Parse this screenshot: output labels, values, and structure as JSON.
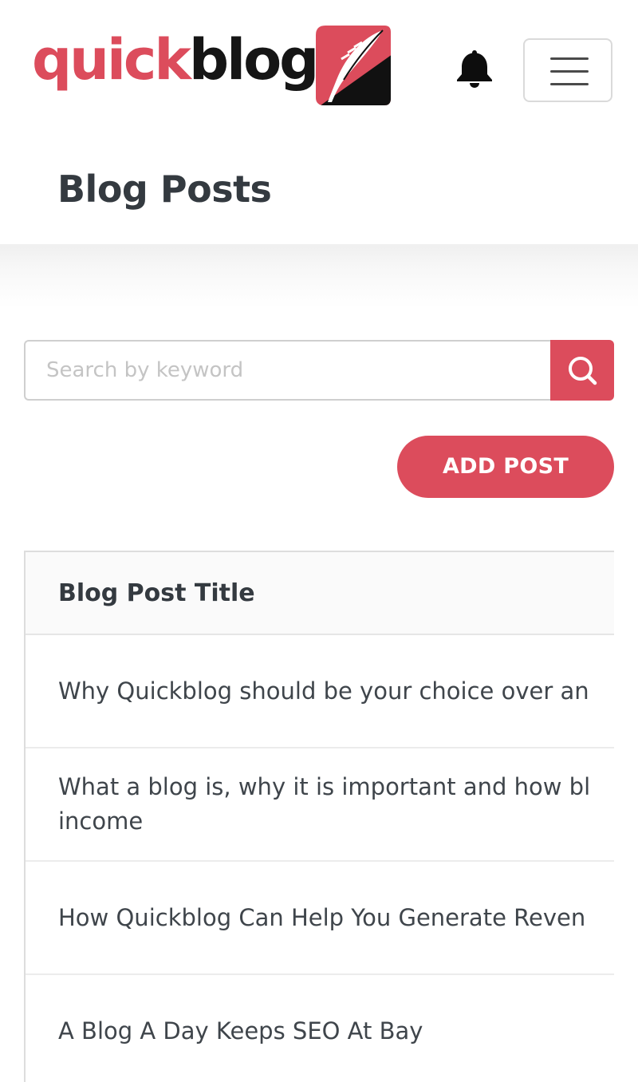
{
  "brand": {
    "name_part1": "quick",
    "name_part2": "blog",
    "accent_color": "#dc4c5c",
    "dark_color": "#151515"
  },
  "header": {
    "notification_icon": "bell-icon",
    "menu_icon": "hamburger-menu-icon"
  },
  "page": {
    "title": "Blog Posts"
  },
  "search": {
    "placeholder": "Search by keyword",
    "value": "",
    "icon": "search-icon"
  },
  "actions": {
    "add_post_label": "ADD POST"
  },
  "table": {
    "columns": [
      "Blog Post Title"
    ],
    "rows": [
      {
        "title": "Why Quickblog should be your choice over an"
      },
      {
        "title": "What a blog is, why it is important and how bl income"
      },
      {
        "title": "How Quickblog Can Help You Generate Reven"
      },
      {
        "title": "A Blog A Day Keeps SEO At Bay"
      }
    ]
  }
}
